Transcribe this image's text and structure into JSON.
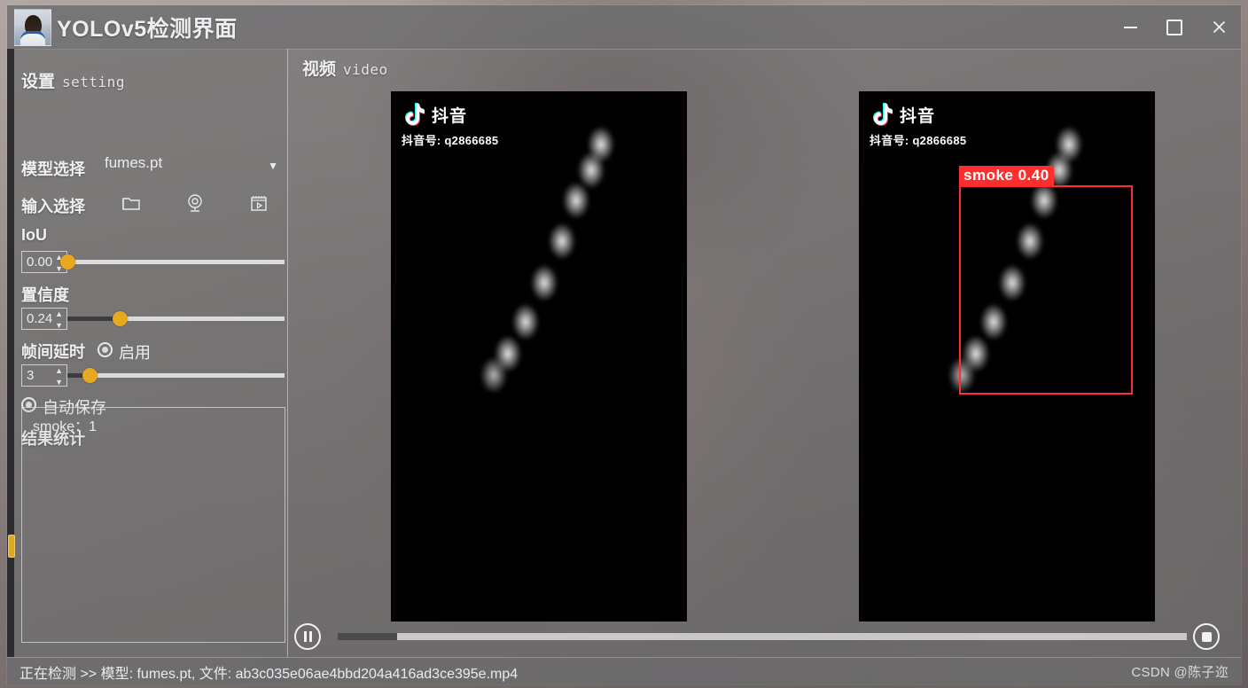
{
  "window": {
    "title": "YOLOv5检测界面",
    "app_icon": "photo-thumbnail-icon",
    "minimize_label": "−",
    "maximize_label": "□",
    "close_label": "✕"
  },
  "sidebar": {
    "section_title": "设置",
    "section_subtitle": "setting",
    "model_label": "模型选择",
    "model_value": "fumes.pt",
    "model_caret": "▼",
    "input_label": "输入选择",
    "input_buttons": [
      {
        "name": "folder-icon",
        "title": "文件"
      },
      {
        "name": "webcam-icon",
        "title": "摄像头"
      },
      {
        "name": "video-file-icon",
        "title": "视频"
      }
    ],
    "iou_label": "IoU",
    "iou_value": "0.00",
    "iou_percent": 0,
    "conf_label": "置信度",
    "conf_value": "0.24",
    "conf_percent": 24,
    "delay_label": "帧间延时",
    "delay_radio_label": "启用",
    "delay_value": "3",
    "delay_percent": 10,
    "autosave_label": "自动保存",
    "stats_label": "结果统计",
    "stats_lines": [
      "smoke：1"
    ],
    "spin_up": "▲",
    "spin_down": "▼"
  },
  "main": {
    "video_title": "视频",
    "video_subtitle": "video",
    "left_frame": {
      "watermark_brand": "抖音",
      "watermark_id": "抖音号: q2866685",
      "detections": []
    },
    "right_frame": {
      "watermark_brand": "抖音",
      "watermark_id": "抖音号: q2866685",
      "detections": [
        {
          "label": "smoke  0.40",
          "class": "smoke",
          "confidence": 0.4,
          "color": "#ff2d2d"
        }
      ]
    },
    "controls": {
      "play_pause": "pause-icon",
      "stop": "stop-icon",
      "progress_percent": 7
    }
  },
  "status": {
    "text": "正在检测 >> 模型: fumes.pt,  文件: ab3c035e06ae4bbd204a416ad3ce395e.mp4",
    "watermark": "CSDN @陈子迩"
  },
  "colors": {
    "accent": "#e8a820",
    "detection": "#ff2d2d",
    "chrome": "#6c6c6e",
    "text": "#eef0f2"
  }
}
